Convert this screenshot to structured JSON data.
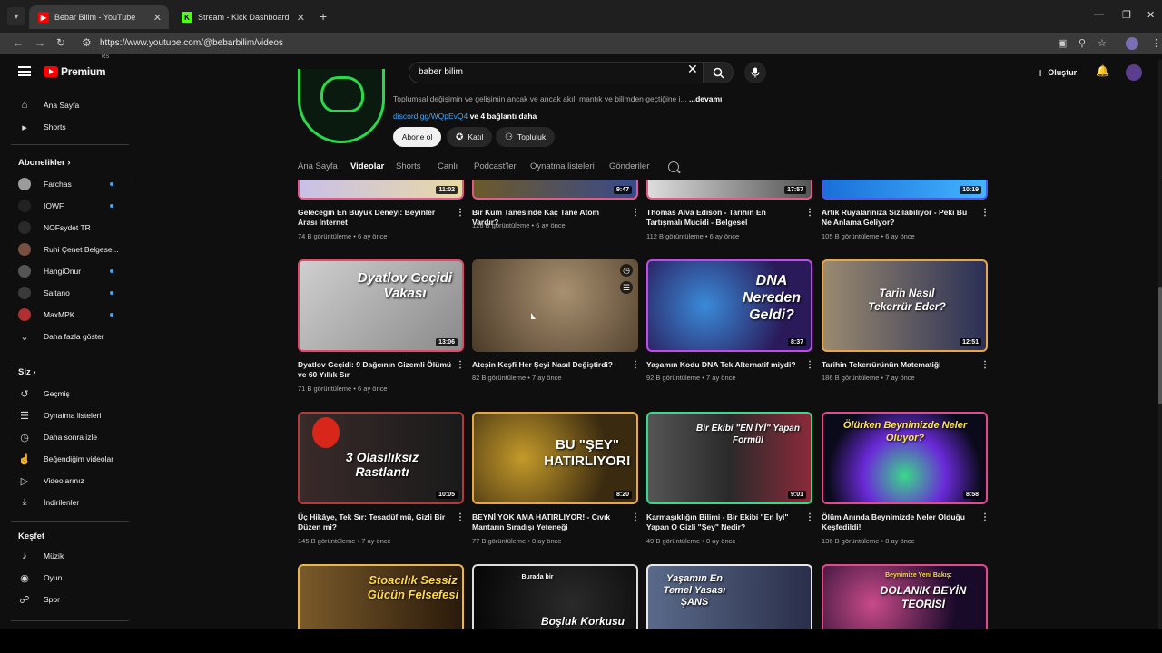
{
  "browser": {
    "tabs": [
      {
        "title": "Bebar Bilim - YouTube",
        "active": true
      },
      {
        "title": "Stream - Kick Dashboard",
        "active": false
      }
    ],
    "url": "https://www.youtube.com/@bebarbilim/videos"
  },
  "header": {
    "logo_text": "Premium",
    "logo_region": "RS",
    "search_value": "baber bilim",
    "create_label": "Oluştur"
  },
  "sidebar": {
    "top": [
      {
        "label": "Ana Sayfa",
        "icon": "home-icon"
      },
      {
        "label": "Shorts",
        "icon": "shorts-icon"
      }
    ],
    "subscriptions_title": "Abonelikler",
    "subscriptions": [
      {
        "label": "Farchas",
        "color": "#9b9b9b",
        "new": true
      },
      {
        "label": "IOWF",
        "color": "#222222",
        "new": true
      },
      {
        "label": "NOFsydet TR",
        "color": "#2a2a2a",
        "new": false
      },
      {
        "label": "Ruhi Çenet Belgese...",
        "color": "#7a4f3f",
        "new": false
      },
      {
        "label": "HangiOnur",
        "color": "#555555",
        "new": true
      },
      {
        "label": "Saltano",
        "color": "#3a3a3a",
        "new": true
      },
      {
        "label": "MaxMPK",
        "color": "#b03030",
        "new": true
      }
    ],
    "show_more": "Daha fazla göster",
    "you_title": "Siz",
    "you_items": [
      {
        "label": "Geçmiş",
        "icon": "history-icon"
      },
      {
        "label": "Oynatma listeleri",
        "icon": "playlist-icon"
      },
      {
        "label": "Daha sonra izle",
        "icon": "watch-later-icon"
      },
      {
        "label": "Beğendiğim videolar",
        "icon": "like-icon"
      },
      {
        "label": "Videolarınız",
        "icon": "your-videos-icon"
      },
      {
        "label": "İndirilenler",
        "icon": "download-icon"
      }
    ],
    "explore_title": "Keşfet",
    "explore_items": [
      {
        "label": "Müzik",
        "icon": "music-icon"
      },
      {
        "label": "Oyun",
        "icon": "gaming-icon"
      },
      {
        "label": "Spor",
        "icon": "trophy-icon"
      }
    ]
  },
  "channel": {
    "description": "Toplumsal değişimin ve gelişimin ancak ve ancak akıl, mantık ve bilimden geçtiğine i...",
    "more": "...devamı",
    "link": "discord.gg/WQpEvQ4",
    "link_extra": "ve 4 bağlantı daha",
    "subscribe": "Abone ol",
    "join": "Katıl",
    "community": "Topluluk",
    "tabs": [
      "Ana Sayfa",
      "Videolar",
      "Shorts",
      "Canlı",
      "Podcast'ler",
      "Oynatma listeleri",
      "Gönderiler"
    ],
    "active_tab": "Videolar"
  },
  "videos_row0": [
    {
      "title": "Geleceğin En Büyük Deneyi: Beyinler Arası İnternet",
      "views": "74 B görüntüleme",
      "age": "6 ay önce",
      "duration": "11:02"
    },
    {
      "title": "Bir Kum Tanesinde Kaç Tane Atom Vardır?",
      "views": "126 B görüntüleme",
      "age": "6 ay önce",
      "duration": "9:47"
    },
    {
      "title": "Thomas Alva Edison - Tarihin En Tartışmalı Mucidi - Belgesel",
      "views": "112 B görüntüleme",
      "age": "6 ay önce",
      "duration": "17:57"
    },
    {
      "title": "Artık Rüyalarınıza Sızılabiliyor - Peki Bu Ne Anlama Geliyor?",
      "views": "105 B görüntüleme",
      "age": "6 ay önce",
      "duration": "10:19"
    }
  ],
  "videos_row1": [
    {
      "title": "Dyatlov Geçidi: 9 Dağcının Gizemli Ölümü ve 60 Yıllık Sır",
      "views": "71 B görüntüleme",
      "age": "6 ay önce",
      "duration": "13:06",
      "thumb_text": "Dyatlov Geçidi Vakası"
    },
    {
      "title": "Ateşin Keşfi Her Şeyi Nasıl Değiştirdi?",
      "views": "82 B görüntüleme",
      "age": "7 ay önce",
      "duration": "",
      "thumb_text": ""
    },
    {
      "title": "Yaşamın Kodu DNA Tek Alternatif miydi?",
      "views": "92 B görüntüleme",
      "age": "7 ay önce",
      "duration": "8:37",
      "thumb_text": "DNA Nereden Geldi?"
    },
    {
      "title": "Tarihin Tekerrürünün Matematiği",
      "views": "186 B görüntüleme",
      "age": "7 ay önce",
      "duration": "12:51",
      "thumb_text": "Tarih Nasıl Tekerrür Eder?"
    }
  ],
  "videos_row2": [
    {
      "title": "Üç Hikâye, Tek Sır: Tesadüf mü, Gizli Bir Düzen mi?",
      "views": "145 B görüntüleme",
      "age": "7 ay önce",
      "duration": "10:05",
      "thumb_text": "3 Olasılıksız Rastlantı"
    },
    {
      "title": "BEYNİ YOK AMA HATIRLIYOR! - Cıvık Mantarın Sıradışı Yeteneği",
      "views": "77 B görüntüleme",
      "age": "8 ay önce",
      "duration": "8:20",
      "thumb_text": "BU \"ŞEY\" HATIRLIYOR!"
    },
    {
      "title": "Karmaşıklığın Bilimi - Bir Ekibi \"En İyi\" Yapan O Gizli \"Şey\" Nedir?",
      "views": "49 B görüntüleme",
      "age": "8 ay önce",
      "duration": "9:01",
      "thumb_text": "Bir Ekibi \"EN İYİ\" Yapan Formül"
    },
    {
      "title": "Ölüm Anında Beynimizde Neler Olduğu Keşfedildi!",
      "views": "136 B görüntüleme",
      "age": "8 ay önce",
      "duration": "8:58",
      "thumb_text": "Ölürken Beynimizde Neler Oluyor?"
    }
  ],
  "videos_row3": [
    {
      "thumb_text": "Stoacılık Sessiz Gücün Felsefesi"
    },
    {
      "thumb_text": "Boşluk Korkusu",
      "thumb_small": "Burada bir"
    },
    {
      "thumb_text": "Yaşamın En Temel Yasası ŞANS"
    },
    {
      "thumb_text": "DOLANIK BEYİN TEORİSİ",
      "thumb_small": "Beynimize Yeni Bakış:"
    }
  ]
}
